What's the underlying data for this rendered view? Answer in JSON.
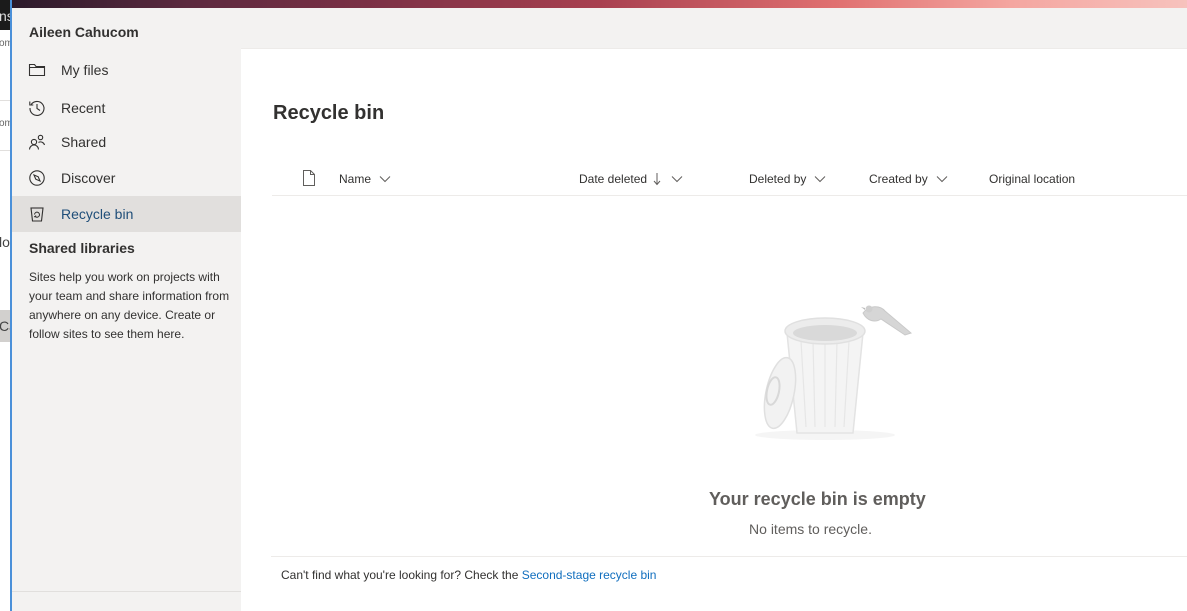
{
  "background_window": {
    "fragments": [
      "nsw",
      "om",
      "om",
      "lo",
      "Ca"
    ]
  },
  "user": {
    "name": "Aileen Cahucom"
  },
  "nav": {
    "items": [
      {
        "label": "My files",
        "icon": "folder-icon",
        "selected": false
      },
      {
        "label": "Recent",
        "icon": "clock-history-icon",
        "selected": false
      },
      {
        "label": "Shared",
        "icon": "people-icon",
        "selected": false
      },
      {
        "label": "Discover",
        "icon": "compass-icon",
        "selected": false
      },
      {
        "label": "Recycle bin",
        "icon": "recycle-bin-icon",
        "selected": true
      }
    ],
    "shared_libraries": {
      "title": "Shared libraries",
      "description": "Sites help you work on projects with your team and share information from anywhere on any device. Create or follow sites to see them here."
    }
  },
  "main": {
    "title": "Recycle bin",
    "columns": [
      {
        "label": "Name",
        "sortable": true
      },
      {
        "label": "Date deleted",
        "sorted": "descending"
      },
      {
        "label": "Deleted by",
        "sortable": true
      },
      {
        "label": "Created by",
        "sortable": true
      },
      {
        "label": "Original location",
        "sortable": false
      }
    ],
    "empty_state": {
      "title": "Your recycle bin is empty",
      "subtitle": "No items to recycle."
    },
    "footer": {
      "text": "Can't find what you're looking for? Check the",
      "link": "Second-stage recycle bin"
    }
  },
  "colors": {
    "accent": "#106ebe",
    "nav_bg": "#f3f2f1",
    "selected_bg": "#e1dfdd",
    "selected_text": "#1f4e79"
  }
}
